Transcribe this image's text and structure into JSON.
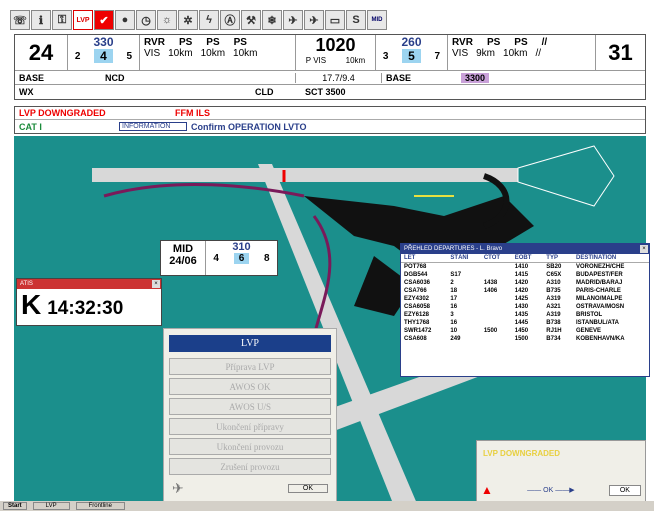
{
  "toolbar": {
    "buttons": [
      {
        "icon": "phone-icon",
        "glyph": "☏"
      },
      {
        "icon": "info-icon",
        "glyph": "ℹ"
      },
      {
        "icon": "key-icon",
        "glyph": "⚿"
      },
      {
        "icon": "lvp-icon",
        "glyph": "LVP"
      },
      {
        "icon": "checkmark-icon",
        "glyph": "✔"
      },
      {
        "icon": "circle-icon",
        "glyph": "●"
      },
      {
        "icon": "clock-icon",
        "glyph": "◷"
      },
      {
        "icon": "sun-icon",
        "glyph": "☼"
      },
      {
        "icon": "gear-icon",
        "glyph": "✲"
      },
      {
        "icon": "lightning-icon",
        "glyph": "ϟ"
      },
      {
        "icon": "alert-circle-icon",
        "glyph": "Ⓐ"
      },
      {
        "icon": "wrench-icon",
        "glyph": "⚒"
      },
      {
        "icon": "snowflake-icon",
        "glyph": "❄"
      },
      {
        "icon": "aircraft-icon",
        "glyph": "✈"
      },
      {
        "icon": "aircraft-alt-icon",
        "glyph": "✈"
      },
      {
        "icon": "blank-icon",
        "glyph": "▭"
      },
      {
        "icon": "s-icon",
        "glyph": "S"
      },
      {
        "icon": "mid-icon",
        "glyph": "MID"
      }
    ]
  },
  "runway_left": {
    "number": "24",
    "wind_dir": "330",
    "wind_a": "2",
    "wind_b": "4",
    "wind_c": "5"
  },
  "runway_right": {
    "number": "31",
    "wind_dir": "260",
    "wind_a": "3",
    "wind_b": "5",
    "wind_c": "7"
  },
  "rvr_left": {
    "rvr_label": "RVR",
    "vis_label": "VIS",
    "cols": [
      "PS",
      "PS",
      "PS"
    ],
    "vis": [
      "10km",
      "10km",
      "10km"
    ]
  },
  "rvr_right": {
    "rvr_label": "RVR",
    "vis_label": "VIS",
    "cols": [
      "PS",
      "PS",
      "//"
    ],
    "vis": [
      "9km",
      "10km",
      "//"
    ]
  },
  "pressure": {
    "qnh": "1020",
    "pvis_label": "P VIS",
    "pvis": "10km",
    "temp": "17.7/9.4"
  },
  "base_left": {
    "label": "BASE",
    "value": "NCD"
  },
  "base_right": {
    "label": "BASE",
    "value": "3300"
  },
  "wx": {
    "label": "WX",
    "cld_label": "CLD",
    "cld": "SCT 3500"
  },
  "alerts": {
    "status": "LVP DOWNGRADED",
    "ils": "FFM ILS",
    "cat": "CAT I",
    "info_label": "INFORMATION",
    "info_text": "Confirm OPERATION LVTO"
  },
  "mid": {
    "label": "MID",
    "date": "24/06",
    "wind_dir": "310",
    "wind_a": "4",
    "wind_b": "6",
    "wind_c": "8"
  },
  "clock": {
    "title": "ATIS",
    "code": "K",
    "time": "14:32:30"
  },
  "lvp_menu": {
    "title": "LVP",
    "items": [
      "Příprava LVP",
      "AWOS OK",
      "AWOS U/S",
      "Ukončení přípravy",
      "Ukončení provozu",
      "Zrušení provozu"
    ],
    "ok_label": "OK"
  },
  "departures": {
    "title": "PŘEHLED DEPARTURES - L. Bravo",
    "headers": [
      "LET",
      "STÁNÍ",
      "CTOT",
      "EOBT",
      "TYP",
      "DESTINATION"
    ],
    "rows": [
      [
        "POT768",
        "",
        "",
        "1410",
        "SB20",
        "VORONEZH/CHE"
      ],
      [
        "DGB544",
        "S17",
        "",
        "1415",
        "C65X",
        "BUDAPEST/FER"
      ],
      [
        "CSA6036",
        "2",
        "1438",
        "1420",
        "A310",
        "MADRID/BARAJ"
      ],
      [
        "CSA766",
        "18",
        "1406",
        "1420",
        "B735",
        "PARIS-CHARLE"
      ],
      [
        "EZY4302",
        "17",
        "",
        "1425",
        "A319",
        "MILANO/MALPE"
      ],
      [
        "CSA6058",
        "16",
        "",
        "1430",
        "A321",
        "OSTRAVA/MOSN"
      ],
      [
        "EZY6128",
        "3",
        "",
        "1435",
        "A319",
        "BRISTOL"
      ],
      [
        "THY1768",
        "16",
        "",
        "1445",
        "B738",
        "ISTANBUL/ATA"
      ],
      [
        "SWR1472",
        "10",
        "1500",
        "1450",
        "RJ1H",
        "GENEVE"
      ],
      [
        "CSA608",
        "249",
        "",
        "1500",
        "B734",
        "KOBENHAVN/KA"
      ]
    ]
  },
  "downgrade_popup": {
    "text": "LVP DOWNGRADED",
    "ok_label": "OK",
    "btn_label": "OK"
  },
  "taskbar": {
    "start": "Start",
    "items": [
      "LVP",
      "Frontline"
    ]
  },
  "colors": {
    "map_bg": "#1b8f8c",
    "runway": "#d8d8d8",
    "taxi": "#7a1a5a",
    "blue_cell": "#9cd4f0",
    "alert_red": "#e00000",
    "title_blue": "#2a3f8a"
  }
}
